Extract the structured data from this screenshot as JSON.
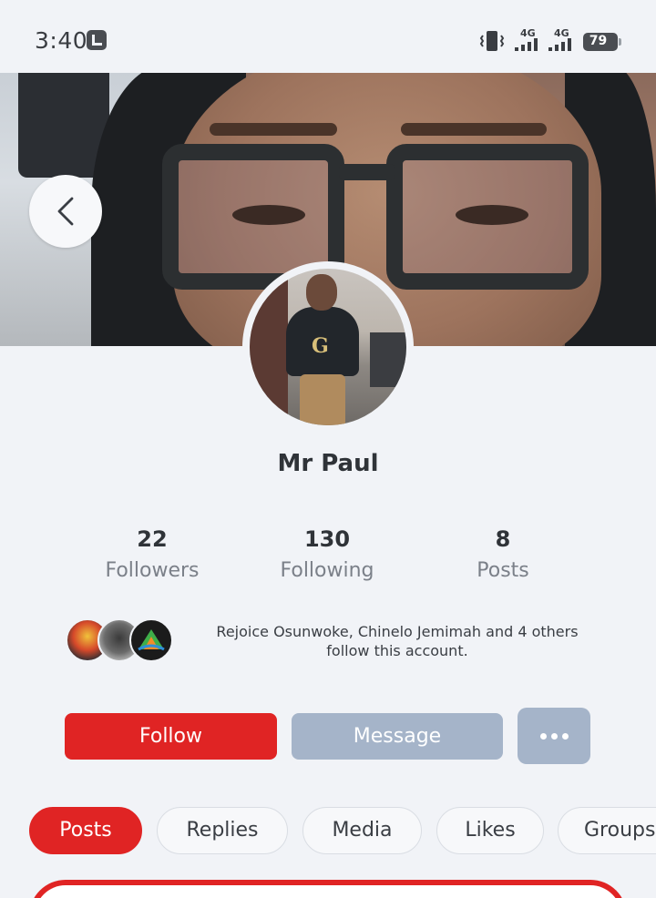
{
  "status_bar": {
    "time": "3:40",
    "network_1": "4G",
    "network_2": "4G",
    "battery": "79"
  },
  "profile": {
    "name": "Mr Paul"
  },
  "stats": [
    {
      "value": "22",
      "label": "Followers"
    },
    {
      "value": "130",
      "label": "Following"
    },
    {
      "value": "8",
      "label": "Posts"
    }
  ],
  "followed_by": {
    "text": "Rejoice Osunwoke, Chinelo Jemimah and 4 others follow this account."
  },
  "actions": {
    "follow_label": "Follow",
    "message_label": "Message"
  },
  "tabs": [
    {
      "label": "Posts",
      "active": true
    },
    {
      "label": "Replies",
      "active": false
    },
    {
      "label": "Media",
      "active": false
    },
    {
      "label": "Likes",
      "active": false
    },
    {
      "label": "Groups",
      "active": false
    }
  ],
  "colors": {
    "accent": "#e02424",
    "muted_button": "#a5b4c9",
    "background": "#f1f3f7"
  },
  "icons": {
    "back": "chevron-left-icon",
    "more": "more-horizontal-icon",
    "notification": "notification-icon",
    "vibrate": "vibrate-icon",
    "signal": "signal-icon",
    "battery": "battery-icon"
  }
}
